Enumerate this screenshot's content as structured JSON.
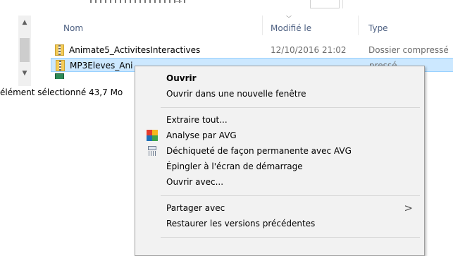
{
  "columns": {
    "name": "Nom",
    "modified": "Modifié le",
    "type": "Type"
  },
  "files": [
    {
      "name": "Animate5_ActivitesInteractives",
      "modified": "12/10/2016 21:02",
      "type": "Dossier compressé"
    },
    {
      "name": "MP3Eleves_Ani",
      "modified": "",
      "type": "pressé"
    }
  ],
  "status": {
    "text": "élément sélectionné  43,7 Mo"
  },
  "context_menu": {
    "items": [
      {
        "label": "Ouvrir",
        "bold": true
      },
      {
        "label": "Ouvrir dans une nouvelle fenêtre"
      },
      {
        "label": "Extraire tout..."
      },
      {
        "label": "Analyse par AVG",
        "icon": "avg-icon"
      },
      {
        "label": "Déchiqueté de façon permanente avec AVG",
        "icon": "shredder-icon"
      },
      {
        "label": "Épingler à l'écran de démarrage"
      },
      {
        "label": "Ouvrir avec..."
      },
      {
        "label": "Partager avec",
        "has_submenu": true
      },
      {
        "label": "Restaurer les versions précédentes"
      }
    ]
  },
  "icons": {
    "submenu": "chevron-right-icon",
    "scroll_up": "scroll-up-arrow-icon",
    "scroll_down": "scroll-down-arrow-icon",
    "file": "zip-folder-icon"
  },
  "colors": {
    "selection": "#cce8ff",
    "selection_border": "#99d1ff",
    "header_text": "#4d6082",
    "menu_bg": "#f2f2f2"
  }
}
